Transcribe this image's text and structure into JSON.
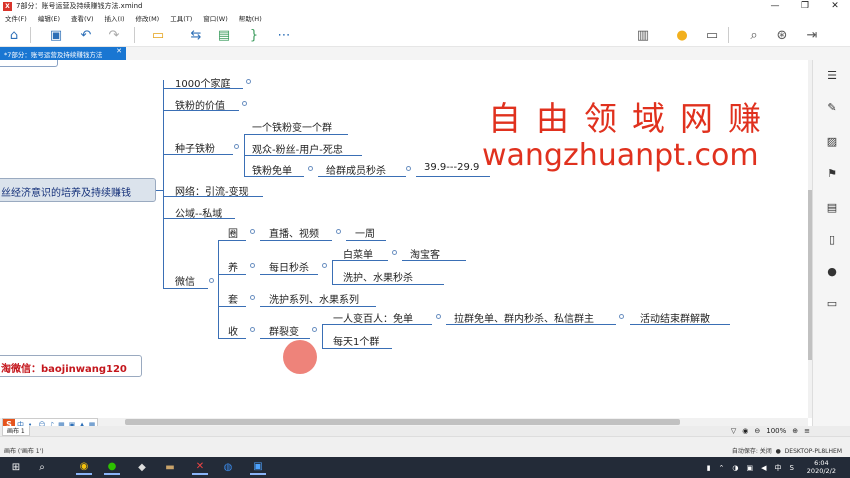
{
  "window": {
    "title": "7部分：账号运营及持续赚钱方法.xmind",
    "app_logo": "X",
    "controls": {
      "minimize": "—",
      "maximize": "❐",
      "close": "✕"
    }
  },
  "menu": [
    "文件(F)",
    "编辑(E)",
    "查看(V)",
    "插入(I)",
    "修改(M)",
    "工具(T)",
    "窗口(W)",
    "帮助(H)"
  ],
  "tab": {
    "label": "*7部分：账号运营及持续赚钱方法",
    "close": "✕"
  },
  "mindmap": {
    "root": "丝经济意识的培养及持续赚钱",
    "wechat_label": "淘微信：baojinwang120",
    "branches": {
      "b1": "1000个家庭",
      "b2": "铁粉的价值",
      "b3": "种子铁粉",
      "b3_1": "一个铁粉变一个群",
      "b3_2": "观众-粉丝-用户-死忠",
      "b3_3": "铁粉免单",
      "b3_3_1": "给群成员秒杀",
      "b3_3_1_1": "39.9---29.9",
      "b4": "网络：引流-变现",
      "b5": "公域--私域",
      "b6": "微信",
      "b6_1": "圈",
      "b6_1_1": "直播、视频",
      "b6_1_1_1": "一周",
      "b6_2": "养",
      "b6_2_1": "每日秒杀",
      "b6_2_1_1": "白菜单",
      "b6_2_1_1_1": "淘宝客",
      "b6_2_1_2": "洗护、水果秒杀",
      "b6_3": "套",
      "b6_3_1": "洗护系列、水果系列",
      "b6_4": "收",
      "b6_4_1": "群裂变",
      "b6_4_1_1": "一人变百人：免单",
      "b6_4_1_1_1": "拉群免单、群内秒杀、私信群主",
      "b6_4_1_1_2": "活动结束群解散",
      "b6_4_1_2": "每天1个群"
    }
  },
  "watermark": {
    "line1": "自由领域网赚",
    "line2": "wangzhuanpt.com"
  },
  "sheet": {
    "tab": "画布 1",
    "zoom": "100%"
  },
  "status": {
    "left": "画布 ('画布 1')",
    "autosave": "自动保存: 关闭",
    "machine": "DESKTOP-PL8LHEM"
  },
  "ime": {
    "logo": "S",
    "mode": "中"
  },
  "clock": {
    "time": "6:04",
    "date": "2020/2/2"
  },
  "tray_lang": "中"
}
